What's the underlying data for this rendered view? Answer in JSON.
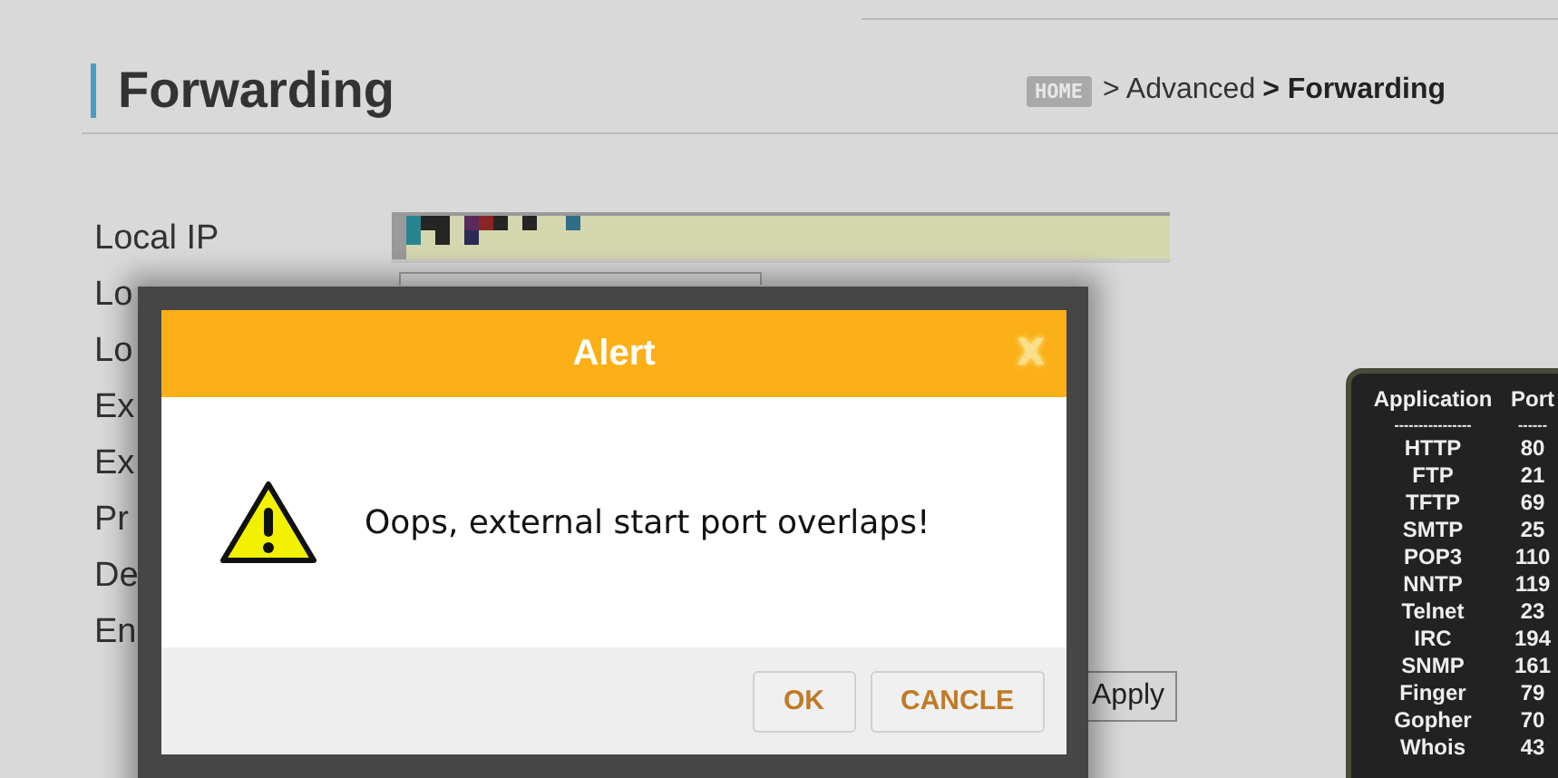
{
  "header": {
    "title": "Forwarding",
    "breadcrumb": [
      {
        "text": "HOME",
        "kind": "home"
      },
      {
        "text": "> Advanced",
        "kind": "link"
      },
      {
        "text": "> Forwarding",
        "kind": "current"
      }
    ]
  },
  "form": {
    "rows": [
      {
        "label": "Local IP",
        "kind": "redacted"
      },
      {
        "label": "Lo",
        "kind": "text"
      },
      {
        "label": "Lo"
      },
      {
        "label": "Ex"
      },
      {
        "label": "Ex"
      },
      {
        "label": "Pr"
      },
      {
        "label": "De"
      },
      {
        "label": "En"
      }
    ],
    "apply": "Apply"
  },
  "dialog": {
    "title": "Alert",
    "close": "X",
    "message": "Oops, external start port overlaps!",
    "buttons": [
      "OK",
      "CANCLE"
    ]
  },
  "port_table": {
    "columns": [
      "Application",
      "Port"
    ],
    "separators": [
      "----------------",
      "------"
    ],
    "rows": [
      [
        "HTTP",
        "80"
      ],
      [
        "FTP",
        "21"
      ],
      [
        "TFTP",
        "69"
      ],
      [
        "SMTP",
        "25"
      ],
      [
        "POP3",
        "110"
      ],
      [
        "NNTP",
        "119"
      ],
      [
        "Telnet",
        "23"
      ],
      [
        "IRC",
        "194"
      ],
      [
        "SNMP",
        "161"
      ],
      [
        "Finger",
        "79"
      ],
      [
        "Gopher",
        "70"
      ],
      [
        "Whois",
        "43"
      ]
    ]
  }
}
